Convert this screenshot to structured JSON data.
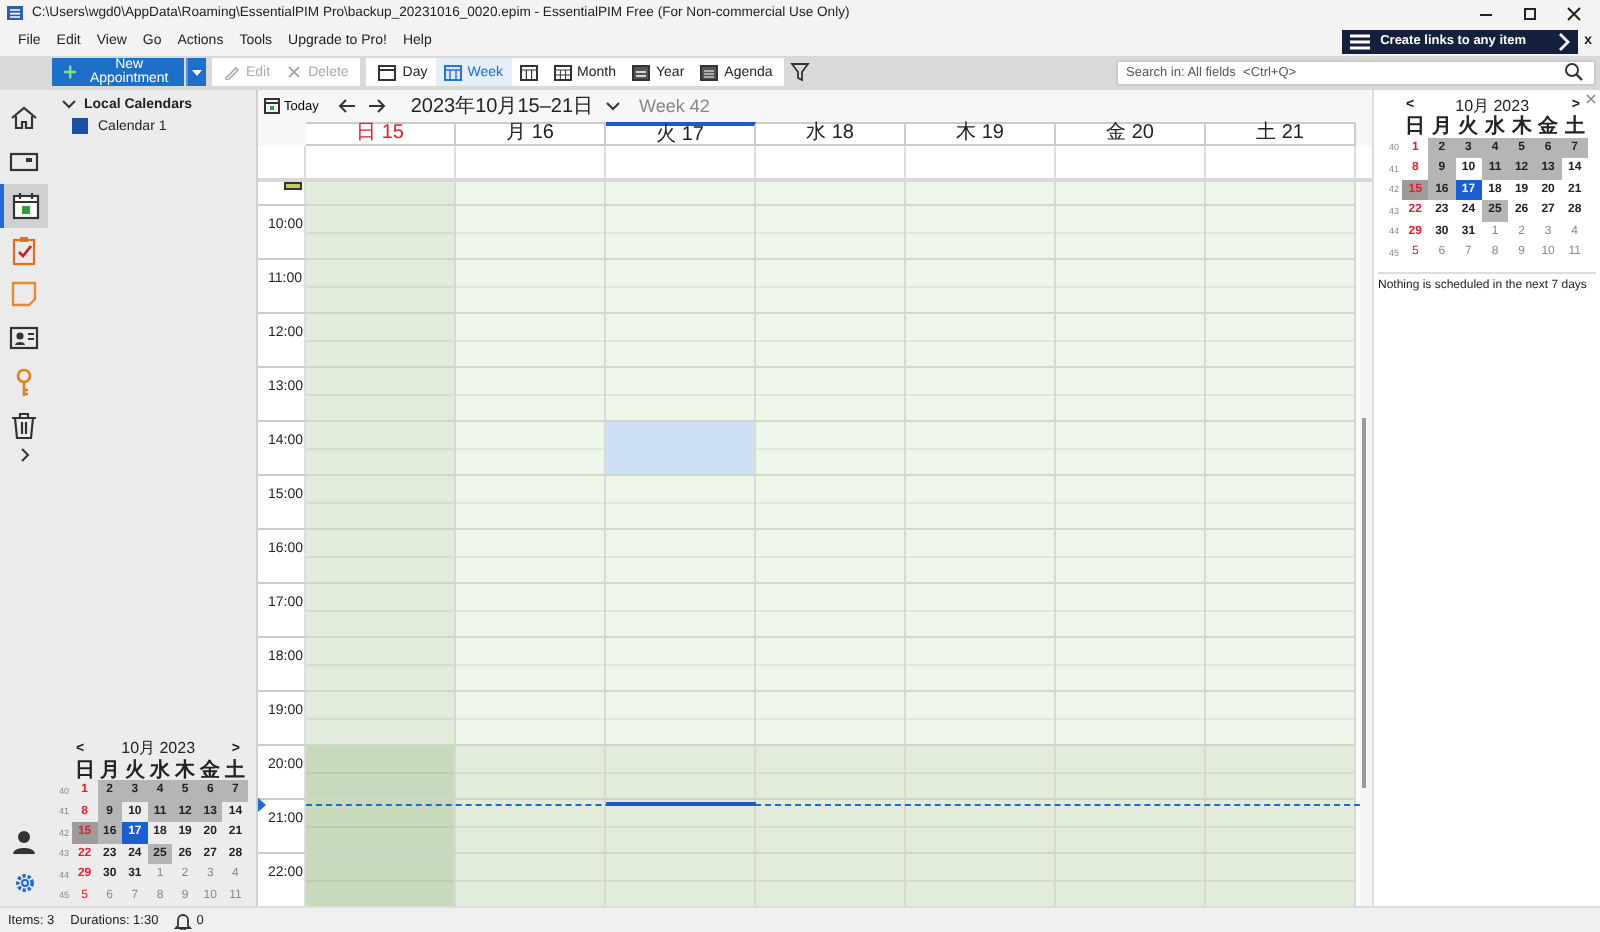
{
  "window": {
    "title": "C:\\Users\\wgd0\\AppData\\Roaming\\EssentialPIM Pro\\backup_20231016_0020.epim - EssentialPIM Free (For Non-commercial Use Only)"
  },
  "menu": [
    "File",
    "Edit",
    "View",
    "Go",
    "Actions",
    "Tools",
    "Upgrade to Pro!",
    "Help"
  ],
  "banner": {
    "text": "Create links to any item",
    "close": "x"
  },
  "toolbar": {
    "new_button": "New Appointment",
    "actions": [
      {
        "label": "Edit",
        "disabled": true
      },
      {
        "label": "Delete",
        "disabled": true
      }
    ],
    "views": [
      {
        "label": "Day",
        "selected": false
      },
      {
        "label": "Week",
        "selected": true
      },
      {
        "selected": false
      },
      {
        "label": "Month",
        "selected": false
      },
      {
        "label": "Year",
        "selected": false
      },
      {
        "label": "Agenda",
        "selected": false
      }
    ],
    "search": {
      "placeholder": "Search in: All fields  <Ctrl+Q>"
    }
  },
  "rail": [
    {
      "selected": false
    },
    {
      "selected": false
    },
    {
      "selected": true
    },
    {
      "selected": false
    },
    {
      "selected": false
    },
    {
      "selected": false
    },
    {
      "selected": false
    },
    {
      "selected": false
    }
  ],
  "calendars": {
    "group": "Local Calendars",
    "expanded": true,
    "items": [
      {
        "name": "Calendar 1",
        "checked": true,
        "color": "#1e4fa8"
      }
    ]
  },
  "navigation": {
    "today": "Today",
    "range": "2023年10月15–21日",
    "week": "Week 42"
  },
  "days": [
    {
      "label": "日 15",
      "sunday": true,
      "today": false
    },
    {
      "label": "月 16",
      "sunday": false,
      "today": false
    },
    {
      "label": "火 17",
      "sunday": false,
      "today": true
    },
    {
      "label": "水 18",
      "sunday": false,
      "today": false
    },
    {
      "label": "木 19",
      "sunday": false,
      "today": false
    },
    {
      "label": "金 20",
      "sunday": false,
      "today": false
    },
    {
      "label": "土 21",
      "sunday": false,
      "today": false
    }
  ],
  "hours": [
    {
      "label": "10:00",
      "off_hours": false,
      "now": false,
      "slots": [
        {
          "selected": false
        },
        {
          "selected": false
        },
        {
          "selected": false
        },
        {
          "selected": false
        },
        {
          "selected": false
        },
        {
          "selected": false
        },
        {
          "selected": false
        }
      ]
    },
    {
      "label": "11:00",
      "off_hours": false,
      "now": false,
      "slots": [
        {
          "selected": false
        },
        {
          "selected": false
        },
        {
          "selected": false
        },
        {
          "selected": false
        },
        {
          "selected": false
        },
        {
          "selected": false
        },
        {
          "selected": false
        }
      ]
    },
    {
      "label": "12:00",
      "off_hours": false,
      "now": false,
      "slots": [
        {
          "selected": false
        },
        {
          "selected": false
        },
        {
          "selected": false
        },
        {
          "selected": false
        },
        {
          "selected": false
        },
        {
          "selected": false
        },
        {
          "selected": false
        }
      ]
    },
    {
      "label": "13:00",
      "off_hours": false,
      "now": false,
      "slots": [
        {
          "selected": false
        },
        {
          "selected": false
        },
        {
          "selected": false
        },
        {
          "selected": false
        },
        {
          "selected": false
        },
        {
          "selected": false
        },
        {
          "selected": false
        }
      ]
    },
    {
      "label": "14:00",
      "off_hours": false,
      "now": false,
      "slots": [
        {
          "selected": false
        },
        {
          "selected": false
        },
        {
          "selected": true
        },
        {
          "selected": false
        },
        {
          "selected": false
        },
        {
          "selected": false
        },
        {
          "selected": false
        }
      ]
    },
    {
      "label": "15:00",
      "off_hours": false,
      "now": false,
      "slots": [
        {
          "selected": false
        },
        {
          "selected": false
        },
        {
          "selected": false
        },
        {
          "selected": false
        },
        {
          "selected": false
        },
        {
          "selected": false
        },
        {
          "selected": false
        }
      ]
    },
    {
      "label": "16:00",
      "off_hours": false,
      "now": false,
      "slots": [
        {
          "selected": false
        },
        {
          "selected": false
        },
        {
          "selected": false
        },
        {
          "selected": false
        },
        {
          "selected": false
        },
        {
          "selected": false
        },
        {
          "selected": false
        }
      ]
    },
    {
      "label": "17:00",
      "off_hours": false,
      "now": false,
      "slots": [
        {
          "selected": false
        },
        {
          "selected": false
        },
        {
          "selected": false
        },
        {
          "selected": false
        },
        {
          "selected": false
        },
        {
          "selected": false
        },
        {
          "selected": false
        }
      ]
    },
    {
      "label": "18:00",
      "off_hours": false,
      "now": false,
      "slots": [
        {
          "selected": false
        },
        {
          "selected": false
        },
        {
          "selected": false
        },
        {
          "selected": false
        },
        {
          "selected": false
        },
        {
          "selected": false
        },
        {
          "selected": false
        }
      ]
    },
    {
      "label": "19:00",
      "off_hours": false,
      "now": false,
      "slots": [
        {
          "selected": false
        },
        {
          "selected": false
        },
        {
          "selected": false
        },
        {
          "selected": false
        },
        {
          "selected": false
        },
        {
          "selected": false
        },
        {
          "selected": false
        }
      ]
    },
    {
      "label": "20:00",
      "off_hours": true,
      "now": false,
      "slots": [
        {
          "selected": false
        },
        {
          "selected": false
        },
        {
          "selected": false
        },
        {
          "selected": false
        },
        {
          "selected": false
        },
        {
          "selected": false
        },
        {
          "selected": false
        }
      ]
    },
    {
      "label": "21:00",
      "off_hours": true,
      "now": true,
      "slots": [
        {
          "selected": false
        },
        {
          "selected": false
        },
        {
          "selected": false
        },
        {
          "selected": false
        },
        {
          "selected": false
        },
        {
          "selected": false
        },
        {
          "selected": false
        }
      ]
    },
    {
      "label": "22:00",
      "off_hours": true,
      "now": false,
      "slots": [
        {
          "selected": false
        },
        {
          "selected": false
        },
        {
          "selected": false
        },
        {
          "selected": false
        },
        {
          "selected": false
        },
        {
          "selected": false
        },
        {
          "selected": false
        }
      ]
    }
  ],
  "mini_calendars": [
    {
      "prev": "<",
      "next": ">",
      "month": "10月 2023",
      "weekdays": [
        "日",
        "月",
        "火",
        "水",
        "木",
        "金",
        "土"
      ],
      "weeks": [
        {
          "week": "40",
          "days": [
            {
              "day": "1",
              "kind": "plain",
              "sunday": true
            },
            {
              "day": "2",
              "kind": "busy",
              "sunday": false
            },
            {
              "day": "3",
              "kind": "busy",
              "sunday": false
            },
            {
              "day": "4",
              "kind": "busy",
              "sunday": false
            },
            {
              "day": "5",
              "kind": "busy",
              "sunday": false
            },
            {
              "day": "6",
              "kind": "busy",
              "sunday": false
            },
            {
              "day": "7",
              "kind": "busy",
              "sunday": false
            }
          ]
        },
        {
          "week": "41",
          "days": [
            {
              "day": "8",
              "kind": "plain",
              "sunday": true
            },
            {
              "day": "9",
              "kind": "busy",
              "sunday": false
            },
            {
              "day": "10",
              "kind": "plain",
              "sunday": false
            },
            {
              "day": "11",
              "kind": "busy",
              "sunday": false
            },
            {
              "day": "12",
              "kind": "busy",
              "sunday": false
            },
            {
              "day": "13",
              "kind": "busy",
              "sunday": false
            },
            {
              "day": "14",
              "kind": "plain",
              "sunday": false
            }
          ]
        },
        {
          "week": "42",
          "days": [
            {
              "day": "15",
              "kind": "busy",
              "sunday": true
            },
            {
              "day": "16",
              "kind": "busy",
              "sunday": false
            },
            {
              "day": "17",
              "kind": "selected",
              "sunday": false
            },
            {
              "day": "18",
              "kind": "plain",
              "sunday": false
            },
            {
              "day": "19",
              "kind": "plain",
              "sunday": false
            },
            {
              "day": "20",
              "kind": "plain",
              "sunday": false
            },
            {
              "day": "21",
              "kind": "plain",
              "sunday": false
            }
          ]
        },
        {
          "week": "43",
          "days": [
            {
              "day": "22",
              "kind": "plain",
              "sunday": true
            },
            {
              "day": "23",
              "kind": "plain",
              "sunday": false
            },
            {
              "day": "24",
              "kind": "plain",
              "sunday": false
            },
            {
              "day": "25",
              "kind": "busy",
              "sunday": false
            },
            {
              "day": "26",
              "kind": "plain",
              "sunday": false
            },
            {
              "day": "27",
              "kind": "plain",
              "sunday": false
            },
            {
              "day": "28",
              "kind": "plain",
              "sunday": false
            }
          ]
        },
        {
          "week": "44",
          "days": [
            {
              "day": "29",
              "kind": "plain",
              "sunday": true
            },
            {
              "day": "30",
              "kind": "plain",
              "sunday": false
            },
            {
              "day": "31",
              "kind": "plain",
              "sunday": false
            },
            {
              "day": "1",
              "kind": "other",
              "sunday": false
            },
            {
              "day": "2",
              "kind": "other",
              "sunday": false
            },
            {
              "day": "3",
              "kind": "other",
              "sunday": false
            },
            {
              "day": "4",
              "kind": "other",
              "sunday": false
            }
          ]
        },
        {
          "week": "45",
          "days": [
            {
              "day": "5",
              "kind": "other",
              "sunday": true
            },
            {
              "day": "6",
              "kind": "other",
              "sunday": false
            },
            {
              "day": "7",
              "kind": "other",
              "sunday": false
            },
            {
              "day": "8",
              "kind": "other",
              "sunday": false
            },
            {
              "day": "9",
              "kind": "other",
              "sunday": false
            },
            {
              "day": "10",
              "kind": "other",
              "sunday": false
            },
            {
              "day": "11",
              "kind": "other",
              "sunday": false
            }
          ]
        }
      ]
    },
    {
      "prev": "<",
      "next": ">",
      "month": "10月 2023",
      "weekdays": [
        "日",
        "月",
        "火",
        "水",
        "木",
        "金",
        "土"
      ],
      "weeks": [
        {
          "week": "40",
          "days": [
            {
              "day": "1",
              "kind": "plain",
              "sunday": true
            },
            {
              "day": "2",
              "kind": "busy",
              "sunday": false
            },
            {
              "day": "3",
              "kind": "busy",
              "sunday": false
            },
            {
              "day": "4",
              "kind": "busy",
              "sunday": false
            },
            {
              "day": "5",
              "kind": "busy",
              "sunday": false
            },
            {
              "day": "6",
              "kind": "busy",
              "sunday": false
            },
            {
              "day": "7",
              "kind": "busy",
              "sunday": false
            }
          ]
        },
        {
          "week": "41",
          "days": [
            {
              "day": "8",
              "kind": "plain",
              "sunday": true
            },
            {
              "day": "9",
              "kind": "busy",
              "sunday": false
            },
            {
              "day": "10",
              "kind": "plain",
              "sunday": false
            },
            {
              "day": "11",
              "kind": "busy",
              "sunday": false
            },
            {
              "day": "12",
              "kind": "busy",
              "sunday": false
            },
            {
              "day": "13",
              "kind": "busy",
              "sunday": false
            },
            {
              "day": "14",
              "kind": "plain",
              "sunday": false
            }
          ]
        },
        {
          "week": "42",
          "days": [
            {
              "day": "15",
              "kind": "busy",
              "sunday": true
            },
            {
              "day": "16",
              "kind": "busy",
              "sunday": false
            },
            {
              "day": "17",
              "kind": "selected",
              "sunday": false
            },
            {
              "day": "18",
              "kind": "plain",
              "sunday": false
            },
            {
              "day": "19",
              "kind": "plain",
              "sunday": false
            },
            {
              "day": "20",
              "kind": "plain",
              "sunday": false
            },
            {
              "day": "21",
              "kind": "plain",
              "sunday": false
            }
          ]
        },
        {
          "week": "43",
          "days": [
            {
              "day": "22",
              "kind": "plain",
              "sunday": true
            },
            {
              "day": "23",
              "kind": "plain",
              "sunday": false
            },
            {
              "day": "24",
              "kind": "plain",
              "sunday": false
            },
            {
              "day": "25",
              "kind": "busy",
              "sunday": false
            },
            {
              "day": "26",
              "kind": "plain",
              "sunday": false
            },
            {
              "day": "27",
              "kind": "plain",
              "sunday": false
            },
            {
              "day": "28",
              "kind": "plain",
              "sunday": false
            }
          ]
        },
        {
          "week": "44",
          "days": [
            {
              "day": "29",
              "kind": "plain",
              "sunday": true
            },
            {
              "day": "30",
              "kind": "plain",
              "sunday": false
            },
            {
              "day": "31",
              "kind": "plain",
              "sunday": false
            },
            {
              "day": "1",
              "kind": "other",
              "sunday": false
            },
            {
              "day": "2",
              "kind": "other",
              "sunday": false
            },
            {
              "day": "3",
              "kind": "other",
              "sunday": false
            },
            {
              "day": "4",
              "kind": "other",
              "sunday": false
            }
          ]
        },
        {
          "week": "45",
          "days": [
            {
              "day": "5",
              "kind": "other",
              "sunday": true
            },
            {
              "day": "6",
              "kind": "other",
              "sunday": false
            },
            {
              "day": "7",
              "kind": "other",
              "sunday": false
            },
            {
              "day": "8",
              "kind": "other",
              "sunday": false
            },
            {
              "day": "9",
              "kind": "other",
              "sunday": false
            },
            {
              "day": "10",
              "kind": "other",
              "sunday": false
            },
            {
              "day": "11",
              "kind": "other",
              "sunday": false
            }
          ]
        }
      ]
    }
  ],
  "agenda": {
    "message": "Nothing is scheduled in the next 7 days"
  },
  "status_bar": {
    "items": "Items: 3",
    "durations": "Durations: 1:30",
    "reminders": "0"
  }
}
